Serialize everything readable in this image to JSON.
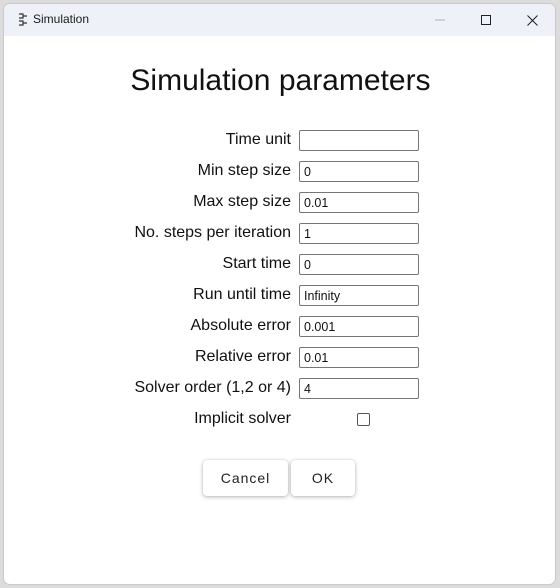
{
  "window": {
    "title": "Simulation"
  },
  "dialog": {
    "heading": "Simulation parameters",
    "fields": [
      {
        "label": "Time unit",
        "value": ""
      },
      {
        "label": "Min step size",
        "value": "0"
      },
      {
        "label": "Max step size",
        "value": "0.01"
      },
      {
        "label": "No. steps per iteration",
        "value": "1"
      },
      {
        "label": "Start time",
        "value": "0"
      },
      {
        "label": "Run until time",
        "value": "Infinity"
      },
      {
        "label": "Absolute error",
        "value": "0.001"
      },
      {
        "label": "Relative error",
        "value": "0.01"
      },
      {
        "label": "Solver order (1,2 or 4)",
        "value": "4"
      }
    ],
    "implicit_solver": {
      "label": "Implicit solver",
      "checked": false
    },
    "buttons": {
      "cancel_label": "Cancel",
      "ok_label": "OK"
    }
  }
}
